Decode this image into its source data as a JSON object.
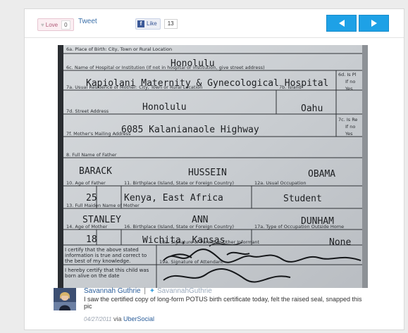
{
  "toolbar": {
    "love_label": "Love",
    "love_count": "0",
    "tweet_label": "Tweet",
    "like_label": "Like",
    "like_count": "13",
    "prev_icon": "arrow-left-icon",
    "next_icon": "arrow-right-icon",
    "accent_color": "#1ea1e6"
  },
  "document": {
    "lines": [
      {
        "label": "6a. Place of Birth: City, Town or Rural Location",
        "value": "Honolulu"
      },
      {
        "label": "6c. Name of Hospital or Institution (If not in hospital or institution, give street address)",
        "value": "Kapiolani Maternity & Gynecological Hospital"
      },
      {
        "label": "7a. Usual Residence of Mother: City, Town or Rural Location",
        "value": "Honolulu"
      },
      {
        "label": "7b. Island",
        "value": "Oahu"
      },
      {
        "label": "7d. Street Address",
        "value": "6085 Kalanianaole Highway"
      },
      {
        "label": "7f. Mother's Mailing Address",
        "value": ""
      },
      {
        "label": "8. Full Name of Father",
        "value": "BARACK"
      },
      {
        "label": "",
        "value": "HUSSEIN"
      },
      {
        "label": "",
        "value": "OBAMA"
      },
      {
        "label": "10. Age of Father",
        "value": "25"
      },
      {
        "label": "11. Birthplace (Island, State or Foreign Country)",
        "value": "Kenya, East Africa"
      },
      {
        "label": "12a. Usual Occupation",
        "value": "Student"
      },
      {
        "label": "13. Full Maiden Name of Mother",
        "value": "STANLEY"
      },
      {
        "label": "",
        "value": "ANN"
      },
      {
        "label": "",
        "value": "DUNHAM"
      },
      {
        "label": "14. Age of Mother",
        "value": "18"
      },
      {
        "label": "16. Birthplace (Island, State or Foreign Country)",
        "value": "Wichita, Kansas"
      },
      {
        "label": "17a. Type of Occupation Outside Home",
        "value": "None"
      },
      {
        "label": "18a. Signature of Parent or Other Informant",
        "value": ""
      },
      {
        "label": "19a. Signature of Attendant",
        "value": ""
      }
    ],
    "side_labels": [
      "6d. Is Pl",
      "If no",
      "Yes",
      "7c. Is Re",
      "If no",
      "Yes"
    ],
    "certify_1": "I certify that the above stated information is true and correct to the best of my knowledge.",
    "certify_2": "I hereby certify that this child was born alive on the date"
  },
  "tweet": {
    "author": "Savannah Guthrie",
    "separator": "|",
    "handle": "SavannahGuthrie",
    "text": "I saw the certified copy of long-form POTUS birth certificate today, felt the raised seal, snapped this pic",
    "date": "04/27/2011",
    "via": "via",
    "source": "UberSocial",
    "bird_icon": "twitter-bird-icon",
    "link_color": "#2a5d9a"
  }
}
